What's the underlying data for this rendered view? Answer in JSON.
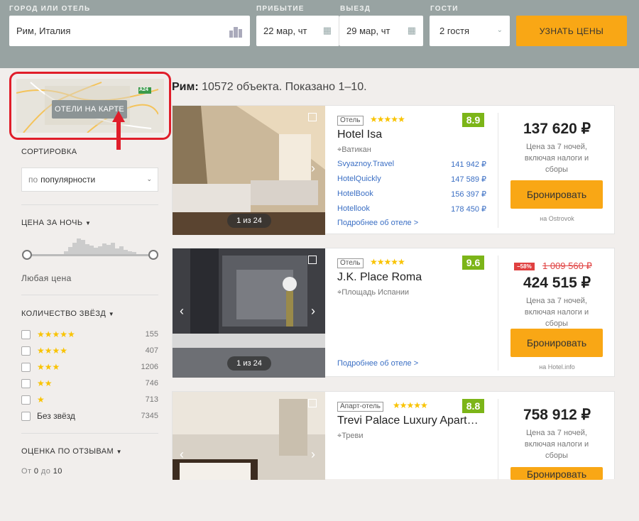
{
  "search": {
    "city_label": "ГОРОД ИЛИ ОТЕЛЬ",
    "city_value": "Рим, Италия",
    "checkin_label": "ПРИБЫТИЕ",
    "checkin_value": "22 мар, чт",
    "checkout_label": "ВЫЕЗД",
    "checkout_value": "29 мар, чт",
    "guests_label": "ГОСТИ",
    "guests_value": "2 гостя",
    "submit": "УЗНАТЬ ЦЕНЫ"
  },
  "map": {
    "button": "ОТЕЛИ НА КАРТЕ",
    "road_label": "A24"
  },
  "sidebar": {
    "sort_label": "СОРТИРОВКА",
    "sort_prefix": "по",
    "sort_value": "популярности",
    "price_label": "ЦЕНА ЗА НОЧЬ",
    "price_any": "Любая цена",
    "stars_label": "КОЛИЧЕСТВО ЗВЁЗД",
    "stars": [
      {
        "stars": "★★★★★",
        "count": "155"
      },
      {
        "stars": "★★★★",
        "count": "407"
      },
      {
        "stars": "★★★",
        "count": "1206"
      },
      {
        "stars": "★★",
        "count": "746"
      },
      {
        "stars": "★",
        "count": "713"
      },
      {
        "stars": "Без звёзд",
        "count": "7345"
      }
    ],
    "reviews_label": "ОЦЕНКА ПО ОТЗЫВАМ",
    "reviews_from": "От",
    "reviews_from_val": "0",
    "reviews_to": "до",
    "reviews_to_val": "10"
  },
  "results": {
    "city": "Рим:",
    "summary": "10572 объекта. Показано 1–10."
  },
  "hotels": [
    {
      "type": "Отель",
      "stars": "★★★★★",
      "name": "Hotel Isa",
      "district": "Ватикан",
      "score": "8.9",
      "photo_count": "1 из 24",
      "offers": [
        {
          "site": "Svyaznoy.Travel",
          "price": "141 942 ₽"
        },
        {
          "site": "HotelQuickly",
          "price": "147 589 ₽"
        },
        {
          "site": "HotelBook",
          "price": "156 397 ₽"
        },
        {
          "site": "Hotellook",
          "price": "178 450 ₽"
        }
      ],
      "more": "Подробнее об отеле >",
      "price": "137 620 ₽",
      "note": "Цена за 7 ночей, включая налоги и сборы",
      "book": "Бронировать",
      "source": "на Ostrovok"
    },
    {
      "type": "Отель",
      "stars": "★★★★★",
      "name": "J.K. Place Roma",
      "district": "Площадь Испании",
      "score": "9.6",
      "photo_count": "1 из 24",
      "discount": "−58%",
      "old_price": "1 009 560 ₽",
      "more": "Подробнее об отеле >",
      "price": "424 515 ₽",
      "note": "Цена за 7 ночей, включая налоги и сборы",
      "book": "Бронировать",
      "source": "на Hotel.info"
    },
    {
      "type": "Апарт-отель",
      "stars": "★★★★★",
      "name": "Trevi Palace Luxury Apart…",
      "district": "Треви",
      "score": "8.8",
      "price": "758 912 ₽",
      "note": "Цена за 7 ночей, включая налоги и сборы",
      "book": "Бронировать"
    }
  ]
}
